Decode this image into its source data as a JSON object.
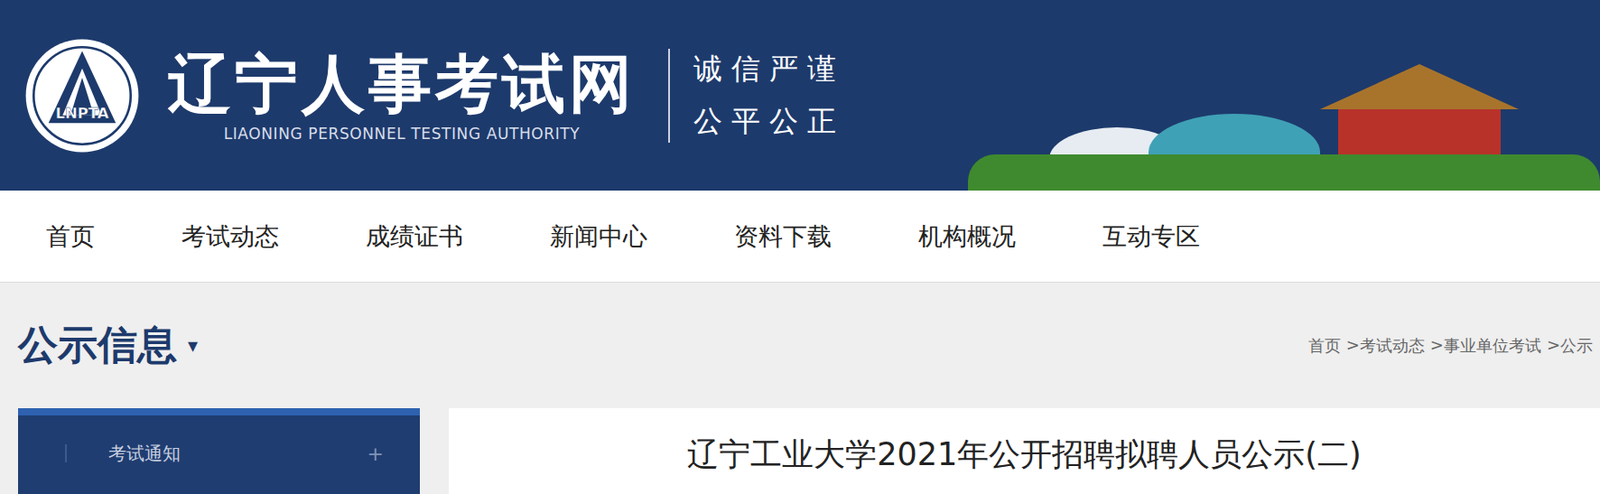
{
  "header": {
    "logo": "LNPTA",
    "title": "辽宁人事考试网",
    "subtitle": "LIAONING PERSONNEL TESTING AUTHORITY",
    "mottos": [
      "诚信严谨",
      "公平公正"
    ]
  },
  "nav": [
    {
      "label": "首页",
      "selected": false
    },
    {
      "label": "考试动态",
      "selected": false
    },
    {
      "label": "成绩证书",
      "selected": false
    },
    {
      "label": "新闻中心",
      "selected": false
    },
    {
      "label": "资料下载",
      "selected": false
    },
    {
      "label": "机构概况",
      "selected": false
    },
    {
      "label": "互动专区",
      "selected": false
    }
  ],
  "section": {
    "title": "公示信息",
    "caret": "▾"
  },
  "breadcrumb": {
    "items": [
      "首页",
      "考试动态",
      "事业单位考试",
      "公示"
    ],
    "separator": ">"
  },
  "sidebar": {
    "items": [
      {
        "label": "考试通知",
        "expanded": false,
        "toggle": "+"
      }
    ]
  },
  "article": {
    "title": "辽宁工业大学2021年公开招聘拟聘人员公示(二)"
  }
}
